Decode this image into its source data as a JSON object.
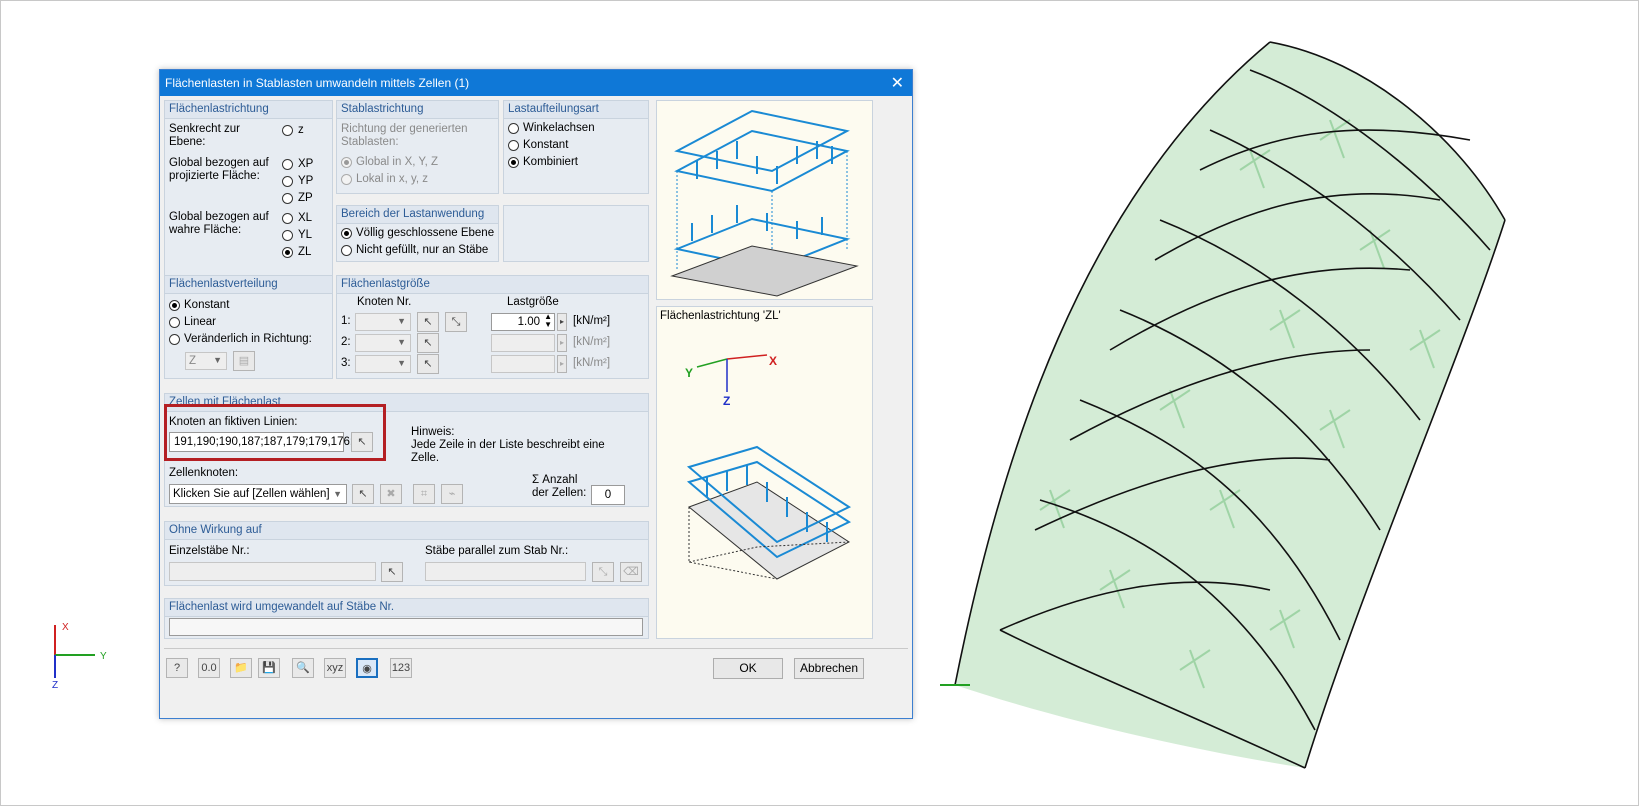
{
  "dialog": {
    "title": "Flächenlasten in Stablasten umwandeln mittels Zellen   (1)",
    "direction": {
      "header": "Flächenlastrichtung",
      "perpendicular_label": "Senkrecht zur\nEbene:",
      "z": "z",
      "global_projected_label": "Global bezogen auf\nprojizierte Fläche:",
      "xp": "XP",
      "yp": "YP",
      "zp": "ZP",
      "global_true_label": "Global bezogen auf\nwahre Fläche:",
      "xl": "XL",
      "yl": "YL",
      "zl": "ZL",
      "selected": "ZL"
    },
    "member_direction": {
      "header": "Stablastrichtung",
      "desc": "Richtung der generierten\nStablasten:",
      "global": "Global in X, Y, Z",
      "local": "Lokal in x, y, z"
    },
    "distribution_type": {
      "header": "Lastaufteilungsart",
      "angle": "Winkelachsen",
      "constant": "Konstant",
      "combined": "Kombiniert",
      "selected": "Kombiniert"
    },
    "range": {
      "header": "Bereich der Lastanwendung",
      "closed": "Völlig geschlossene Ebene",
      "not_filled": "Nicht gefüllt, nur an Stäbe"
    },
    "load_distribution": {
      "header": "Flächenlastverteilung",
      "constant": "Konstant",
      "linear": "Linear",
      "variable": "Veränderlich in Richtung:",
      "axis": "Z"
    },
    "load_size": {
      "header": "Flächenlastgröße",
      "node_col": "Knoten Nr.",
      "load_col": "Lastgröße",
      "rows": [
        "1:",
        "2:",
        "3:"
      ],
      "value1": "1.00",
      "unit": "[kN/m²]"
    },
    "cells": {
      "header": "Zellen mit Flächenlast",
      "nodes_label": "Knoten an fiktiven Linien:",
      "nodes_value": "191,190;190,187;187,179;179,176;",
      "hint_title": "Hinweis:",
      "hint_text": "Jede Zeile in der Liste beschreibt eine\nZelle.",
      "cell_nodes_label": "Zellenknoten:",
      "cell_nodes_value": "Klicken Sie auf [Zellen wählen]",
      "count_label": "Σ Anzahl\nder Zellen:",
      "count_value": "0"
    },
    "no_effect": {
      "header": "Ohne Wirkung auf",
      "single_members": "Einzelstäbe Nr.:",
      "parallel_members": "Stäbe parallel zum Stab Nr.:"
    },
    "converted": {
      "header": "Flächenlast wird umgewandelt auf Stäbe Nr."
    },
    "preview_label": "Flächenlastrichtung 'ZL'",
    "ok": "OK",
    "cancel": "Abbrechen"
  },
  "axes": {
    "x": "X",
    "y": "Y",
    "z": "Z"
  },
  "colors": {
    "titlebar": "#0f78d7",
    "highlight": "#b41f23",
    "load_blue": "#1a8ad4",
    "mesh_green": "#9fd4a6"
  }
}
